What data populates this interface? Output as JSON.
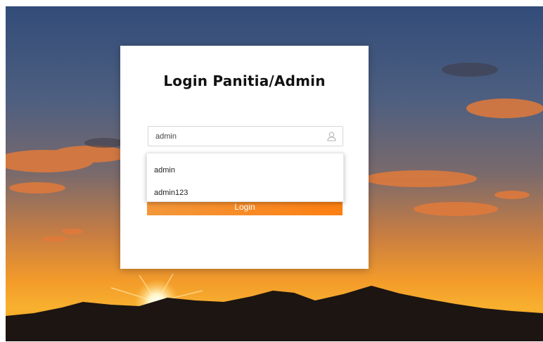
{
  "login": {
    "title": "Login Panitia/Admin",
    "username_value": "admin",
    "login_label": "Login"
  },
  "autocomplete": {
    "suggestions": [
      "admin",
      "admin123"
    ]
  },
  "icons": {
    "username": "user-icon"
  },
  "colors": {
    "button_start": "#f3973a",
    "button_end": "#fd7f12"
  }
}
